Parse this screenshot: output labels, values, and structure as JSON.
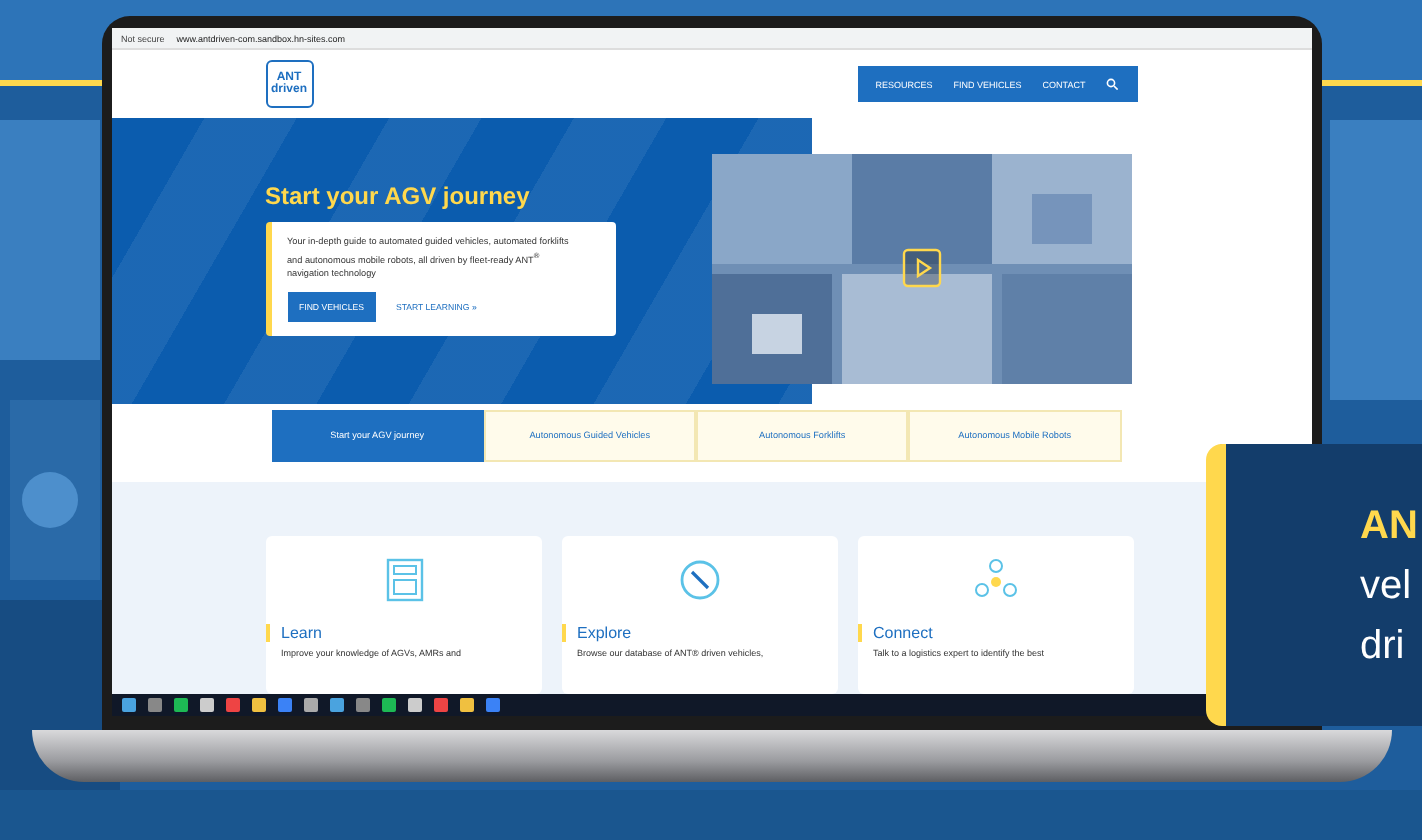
{
  "browser": {
    "security": "Not secure",
    "url": "www.antdriven-com.sandbox.hn-sites.com"
  },
  "site": {
    "logo": [
      "ANT",
      "driven"
    ],
    "nav": [
      "RESOURCES",
      "FIND VEHICLES",
      "CONTACT"
    ],
    "hero": {
      "title": "Start your AGV journey",
      "text": "Your in-depth guide to automated guided vehicles, automated forklifts and autonomous mobile robots, all driven by fleet-ready ANT$^{®}$ navigation technology",
      "primary": "FIND VEHICLES",
      "link": "START LEARNING",
      "link_arrow": "»"
    },
    "tabs": [
      {
        "label": "Start your AGV journey",
        "selected": true
      },
      {
        "label": "Autonomous Guided Vehicles",
        "selected": false
      },
      {
        "label": "Autonomous Forklifts",
        "selected": false
      },
      {
        "label": "Autonomous Mobile Robots",
        "selected": false
      }
    ],
    "cards": [
      {
        "kind": "calculator",
        "title": "Learn",
        "text": "Improve your knowledge of AGVs, AMRs and"
      },
      {
        "kind": "compass",
        "title": "Explore",
        "text": "Browse our database of ANT® driven vehicles,"
      },
      {
        "kind": "network",
        "title": "Connect",
        "text": "Talk to a logistics expert to identify the best"
      }
    ]
  },
  "callout": [
    {
      "text": "AN",
      "highlight": true
    },
    {
      "text": "vel",
      "highlight": false
    },
    {
      "text": "dri",
      "highlight": false
    }
  ]
}
